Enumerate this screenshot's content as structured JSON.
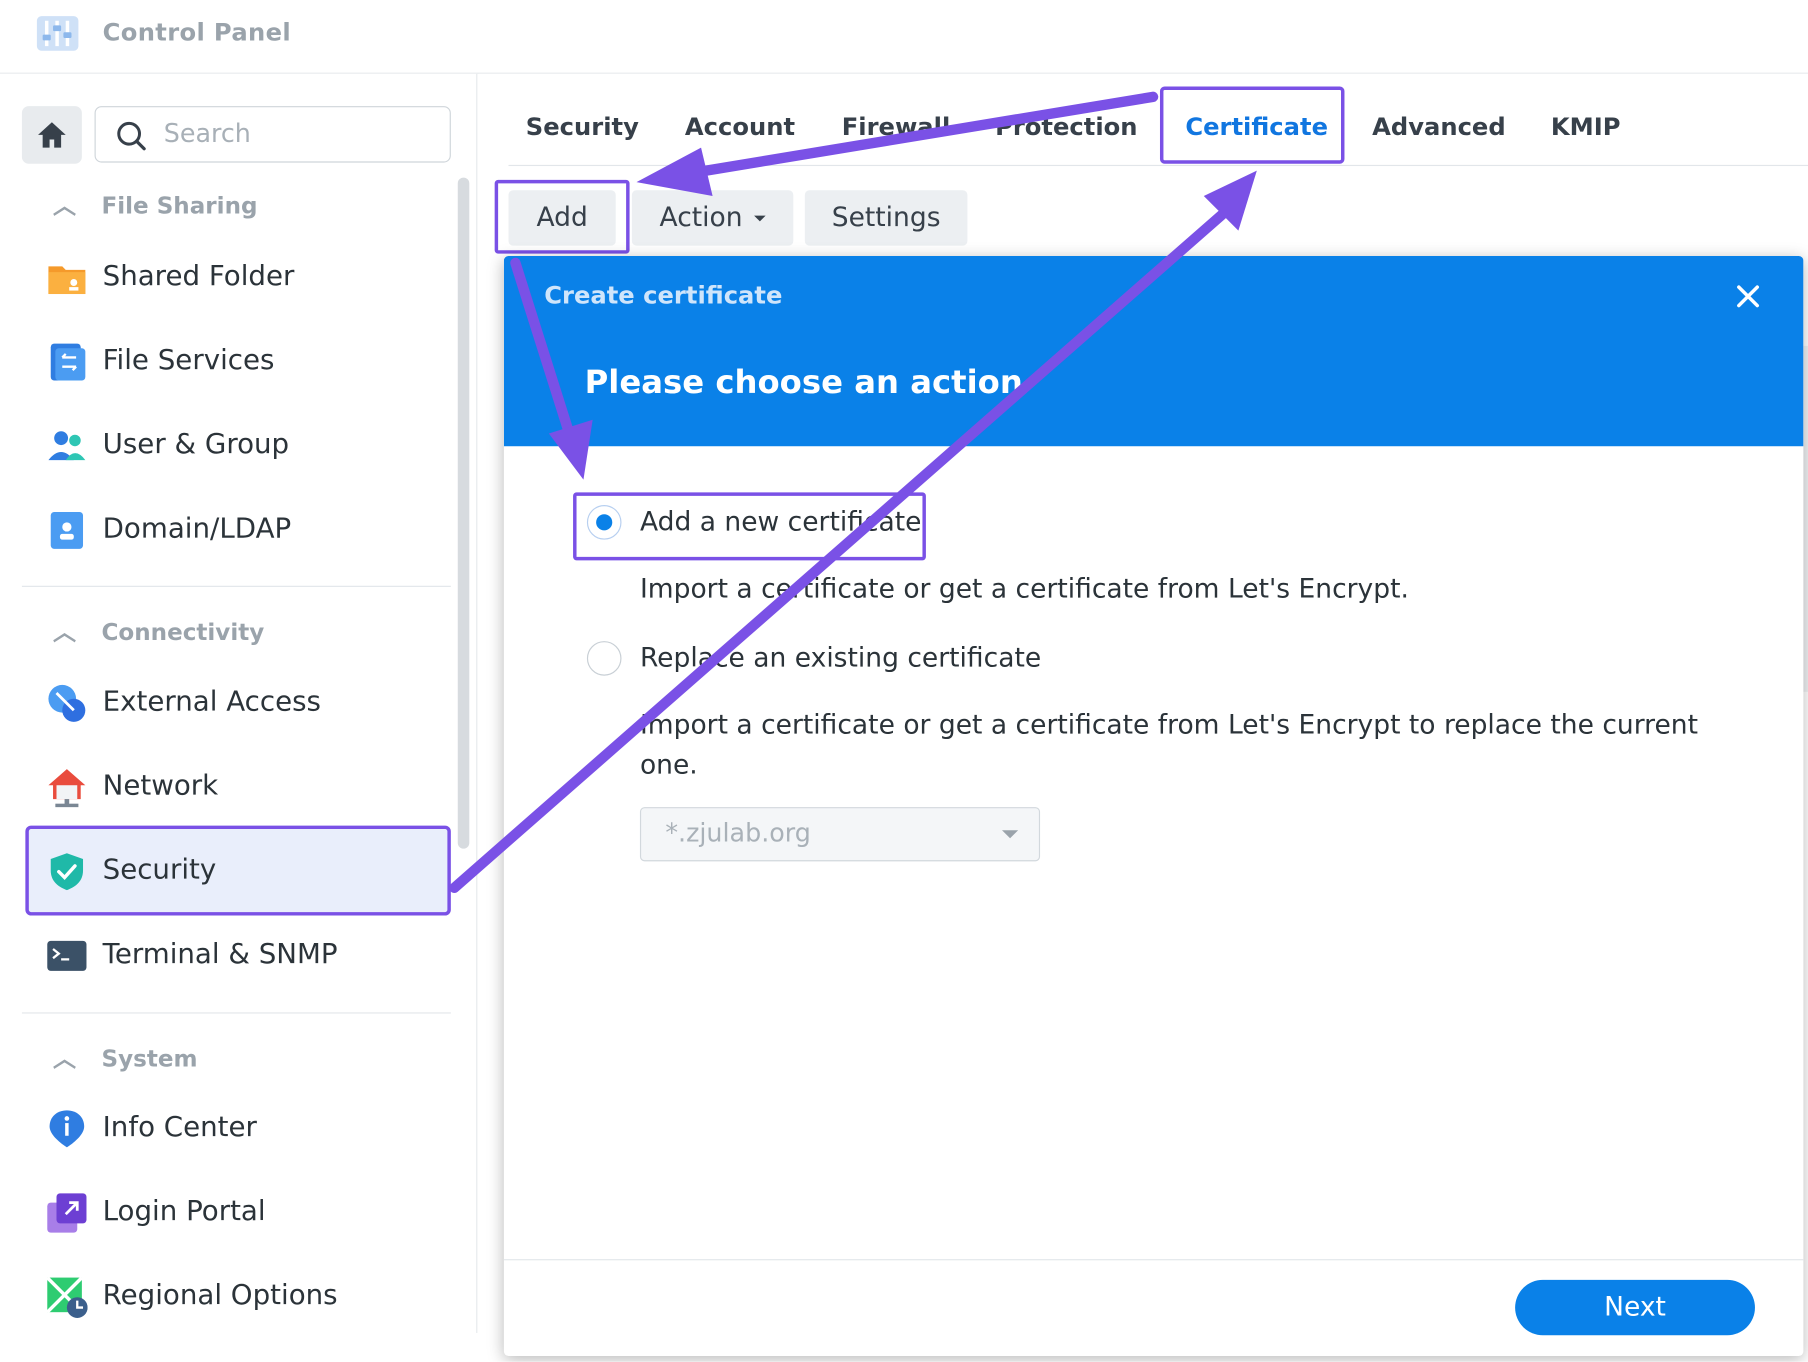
{
  "app": {
    "title": "Control Panel"
  },
  "search": {
    "placeholder": "Search"
  },
  "sidebar": {
    "sections": [
      {
        "label": "File Sharing"
      },
      {
        "label": "Connectivity"
      },
      {
        "label": "System"
      }
    ],
    "items": [
      {
        "label": "Shared Folder",
        "icon": "folder-icon"
      },
      {
        "label": "File Services",
        "icon": "file-services-icon"
      },
      {
        "label": "User & Group",
        "icon": "users-icon"
      },
      {
        "label": "Domain/LDAP",
        "icon": "domain-icon"
      },
      {
        "label": "External Access",
        "icon": "external-access-icon"
      },
      {
        "label": "Network",
        "icon": "network-icon"
      },
      {
        "label": "Security",
        "icon": "shield-icon",
        "active": true
      },
      {
        "label": "Terminal & SNMP",
        "icon": "terminal-icon"
      },
      {
        "label": "Info Center",
        "icon": "info-icon"
      },
      {
        "label": "Login Portal",
        "icon": "login-portal-icon"
      },
      {
        "label": "Regional Options",
        "icon": "regional-options-icon"
      }
    ]
  },
  "tabs": [
    {
      "label": "Security"
    },
    {
      "label": "Account"
    },
    {
      "label": "Firewall"
    },
    {
      "label": "Protection"
    },
    {
      "label": "Certificate",
      "selected": true
    },
    {
      "label": "Advanced"
    },
    {
      "label": "KMIP"
    }
  ],
  "toolbar": {
    "add": "Add",
    "action": "Action",
    "settings": "Settings"
  },
  "dialog": {
    "title": "Create certificate",
    "subtitle": "Please choose an action",
    "options": [
      {
        "label": "Add a new certificate",
        "desc": "Import a certificate or get a certificate from Let's Encrypt.",
        "selected": true
      },
      {
        "label": "Replace an existing certificate",
        "desc": "Import a certificate or get a certificate from Let's Encrypt to replace the current one.",
        "selected": false
      }
    ],
    "select_value": "*.zjulab.org",
    "next": "Next"
  },
  "colors": {
    "accent": "#0a81e8",
    "highlight": "#7a51e6"
  }
}
